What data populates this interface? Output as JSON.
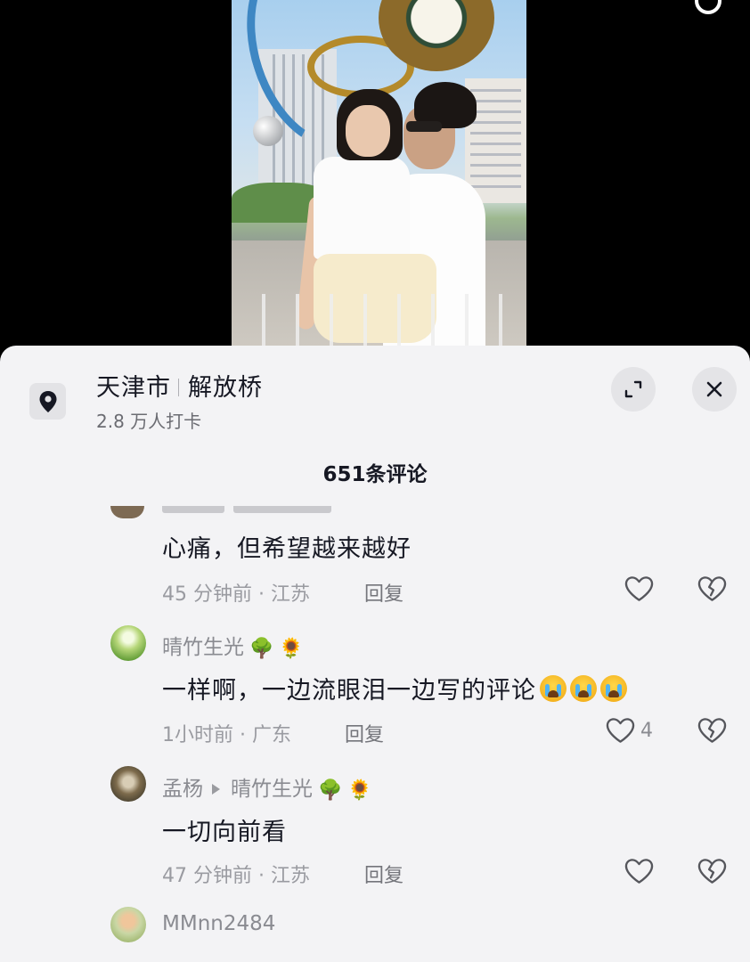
{
  "location": {
    "city": "天津市",
    "place": "解放桥",
    "checkins": "2.8 万人打卡"
  },
  "comments_header": {
    "title": "651条评论"
  },
  "comments": [
    {
      "text": "心痛，但希望越来越好",
      "meta": "45 分钟前 · 江苏",
      "reply_label": "回复"
    },
    {
      "username": "晴竹生光",
      "username_emojis": [
        "🌳",
        "🌻"
      ],
      "text": "一样啊，一边流眼泪一边写的评论",
      "text_emoji": "loudly-crying-face",
      "text_emoji_count": 3,
      "meta": "1小时前 · 广东",
      "reply_label": "回复",
      "like_count": "4"
    },
    {
      "username": "孟杨",
      "reply_to": "晴竹生光",
      "reply_to_emojis": [
        "🌳",
        "🌻"
      ],
      "text": "一切向前看",
      "meta": "47 分钟前 · 江苏",
      "reply_label": "回复"
    },
    {
      "username": "MMnn2484"
    }
  ],
  "icons": {
    "location": "map-pin-icon",
    "expand": "expand-icon",
    "close": "close-icon",
    "like": "heart-outline-icon",
    "dislike": "broken-heart-icon",
    "search": "search-icon"
  }
}
